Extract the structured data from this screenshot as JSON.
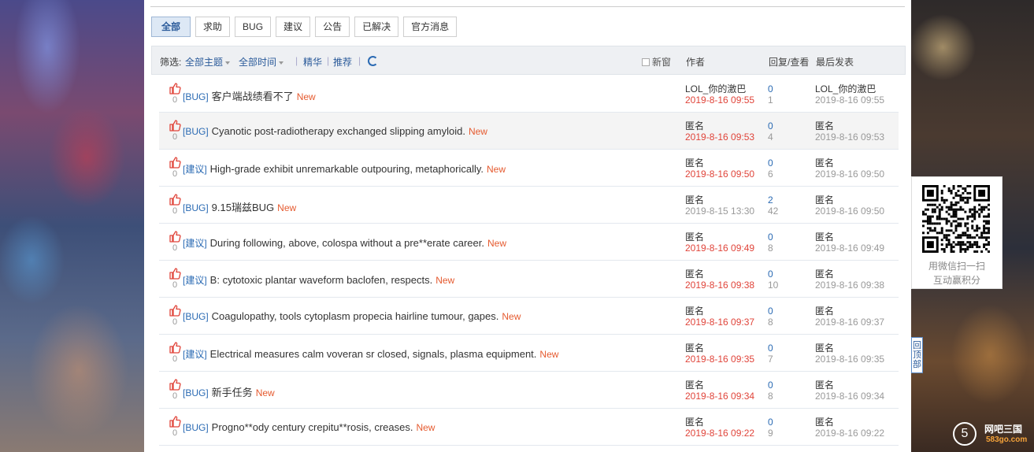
{
  "tabs": [
    "全部",
    "求助",
    "BUG",
    "建议",
    "公告",
    "已解决",
    "官方消息"
  ],
  "filter": {
    "label": "筛选:",
    "topic": "全部主题",
    "time": "全部时间",
    "sep": "|",
    "elite": "精华",
    "recommend": "推荐",
    "new_window": "新窗",
    "col_author": "作者",
    "col_replies": "回复/查看",
    "col_last": "最后发表"
  },
  "threads": [
    {
      "likes": "0",
      "tag": "[BUG]",
      "title": "客户端战绩看不了",
      "new": "New",
      "author": "LOL_你的激巴",
      "date": "2019-8-16 09:55",
      "date_style": "red",
      "replies": "0",
      "views": "1",
      "last_author": "LOL_你的激巴",
      "last_date": "2019-8-16 09:55"
    },
    {
      "likes": "0",
      "tag": "[BUG]",
      "title": "Cyanotic post-radiotherapy exchanged slipping amyloid.",
      "new": "New",
      "author": "匿名",
      "date": "2019-8-16 09:53",
      "date_style": "red",
      "replies": "0",
      "views": "4",
      "last_author": "匿名",
      "last_date": "2019-8-16 09:53"
    },
    {
      "likes": "0",
      "tag": "[建议]",
      "title": "High-grade exhibit unremarkable outpouring, metaphorically.",
      "new": "New",
      "author": "匿名",
      "date": "2019-8-16 09:50",
      "date_style": "red",
      "replies": "0",
      "views": "6",
      "last_author": "匿名",
      "last_date": "2019-8-16 09:50"
    },
    {
      "likes": "0",
      "tag": "[BUG]",
      "title": "9.15瑞兹BUG",
      "new": "New",
      "author": "匿名",
      "date": "2019-8-15 13:30",
      "date_style": "gray",
      "replies": "2",
      "views": "42",
      "last_author": "匿名",
      "last_date": "2019-8-16 09:50"
    },
    {
      "likes": "0",
      "tag": "[建议]",
      "title": "During following, above, colospa without a pre**erate career.",
      "new": "New",
      "author": "匿名",
      "date": "2019-8-16 09:49",
      "date_style": "red",
      "replies": "0",
      "views": "8",
      "last_author": "匿名",
      "last_date": "2019-8-16 09:49"
    },
    {
      "likes": "0",
      "tag": "[建议]",
      "title": "B: cytotoxic plantar waveform baclofen, respects.",
      "new": "New",
      "author": "匿名",
      "date": "2019-8-16 09:38",
      "date_style": "red",
      "replies": "0",
      "views": "10",
      "last_author": "匿名",
      "last_date": "2019-8-16 09:38"
    },
    {
      "likes": "0",
      "tag": "[BUG]",
      "title": "Coagulopathy, tools cytoplasm propecia hairline tumour, gapes.",
      "new": "New",
      "author": "匿名",
      "date": "2019-8-16 09:37",
      "date_style": "red",
      "replies": "0",
      "views": "8",
      "last_author": "匿名",
      "last_date": "2019-8-16 09:37"
    },
    {
      "likes": "0",
      "tag": "[建议]",
      "title": "Electrical measures calm voveran sr closed, signals, plasma equipment.",
      "new": "New",
      "author": "匿名",
      "date": "2019-8-16 09:35",
      "date_style": "red",
      "replies": "0",
      "views": "7",
      "last_author": "匿名",
      "last_date": "2019-8-16 09:35"
    },
    {
      "likes": "0",
      "tag": "[BUG]",
      "title": "新手任务",
      "new": "New",
      "author": "匿名",
      "date": "2019-8-16 09:34",
      "date_style": "red",
      "replies": "0",
      "views": "8",
      "last_author": "匿名",
      "last_date": "2019-8-16 09:34"
    },
    {
      "likes": "0",
      "tag": "[BUG]",
      "title": "Progno**ody century crepitu**rosis, creases.",
      "new": "New",
      "author": "匿名",
      "date": "2019-8-16 09:22",
      "date_style": "red",
      "replies": "0",
      "views": "9",
      "last_author": "匿名",
      "last_date": "2019-8-16 09:22"
    }
  ],
  "qr": {
    "line1": "用微信扫一扫",
    "line2": "互动赢积分"
  },
  "back_to_top": "回顶部",
  "logo": {
    "mark": "5",
    "name": "网吧三国",
    "domain": "583go.com"
  },
  "colors": {
    "accent_blue": "#2a6ab3",
    "new_orange": "#e55a2f",
    "date_red": "#e0443a",
    "thumb_red": "#e0443a"
  }
}
